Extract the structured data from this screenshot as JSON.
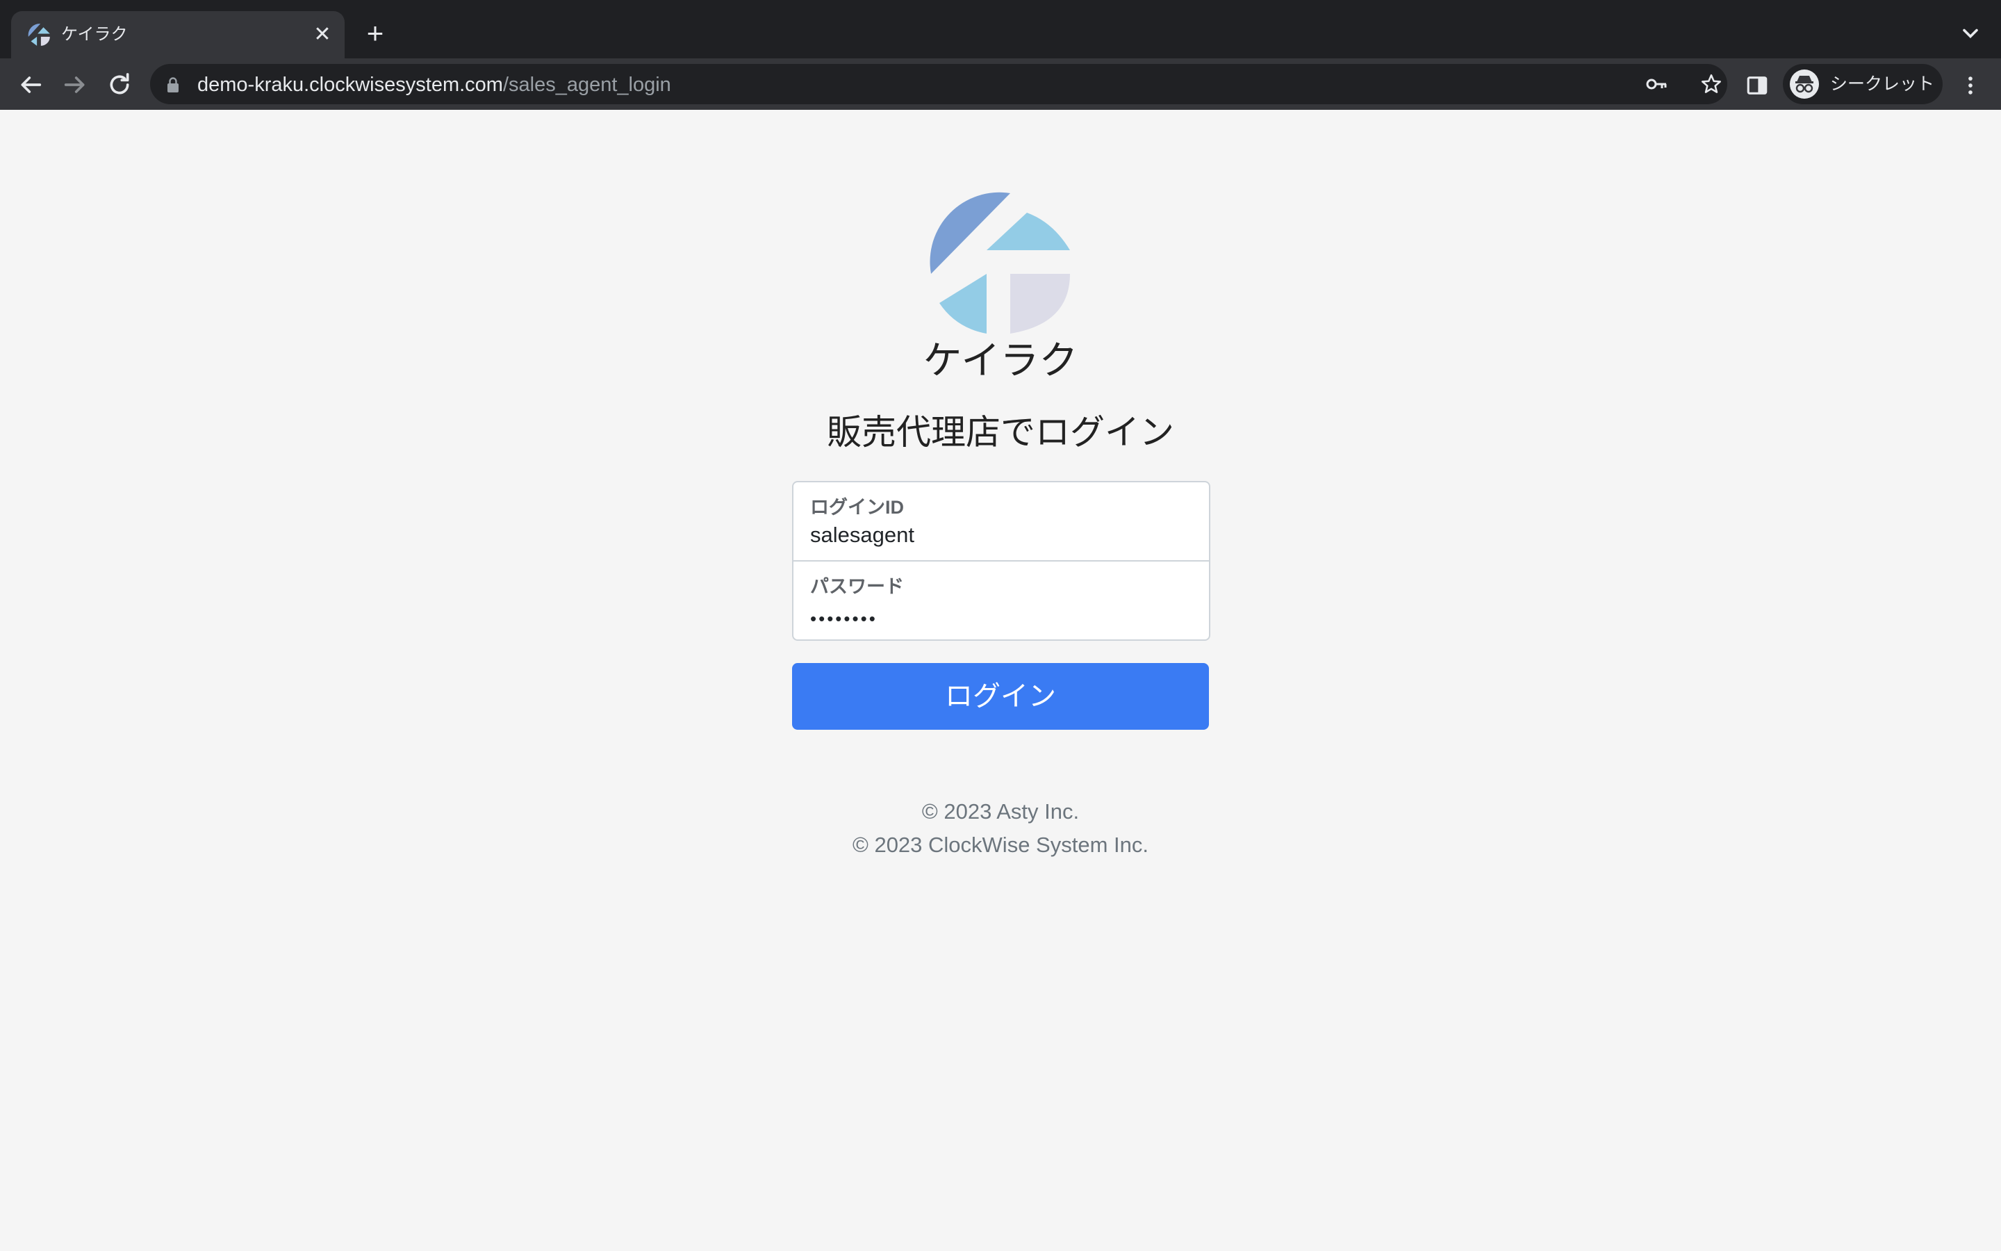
{
  "browser": {
    "tab": {
      "title": "ケイラク"
    },
    "address_bar": {
      "host": "demo-kraku.clockwisesystem.com",
      "path": "/sales_agent_login"
    },
    "profile": {
      "label": "シークレット"
    }
  },
  "page": {
    "brand_name": "ケイラク",
    "heading": "販売代理店でログイン",
    "form": {
      "login_id": {
        "label": "ログインID",
        "value": "salesagent"
      },
      "password": {
        "label": "パスワード",
        "value": "••••••••"
      }
    },
    "login_button": "ログイン",
    "footer": [
      "© 2023 Asty Inc.",
      "© 2023 ClockWise System Inc."
    ]
  },
  "colors": {
    "primary_button": "#3a7bf3",
    "logo_blue_dark": "#7b9fd4",
    "logo_blue_light": "#93cce6",
    "logo_lavender": "#dcdce8"
  }
}
